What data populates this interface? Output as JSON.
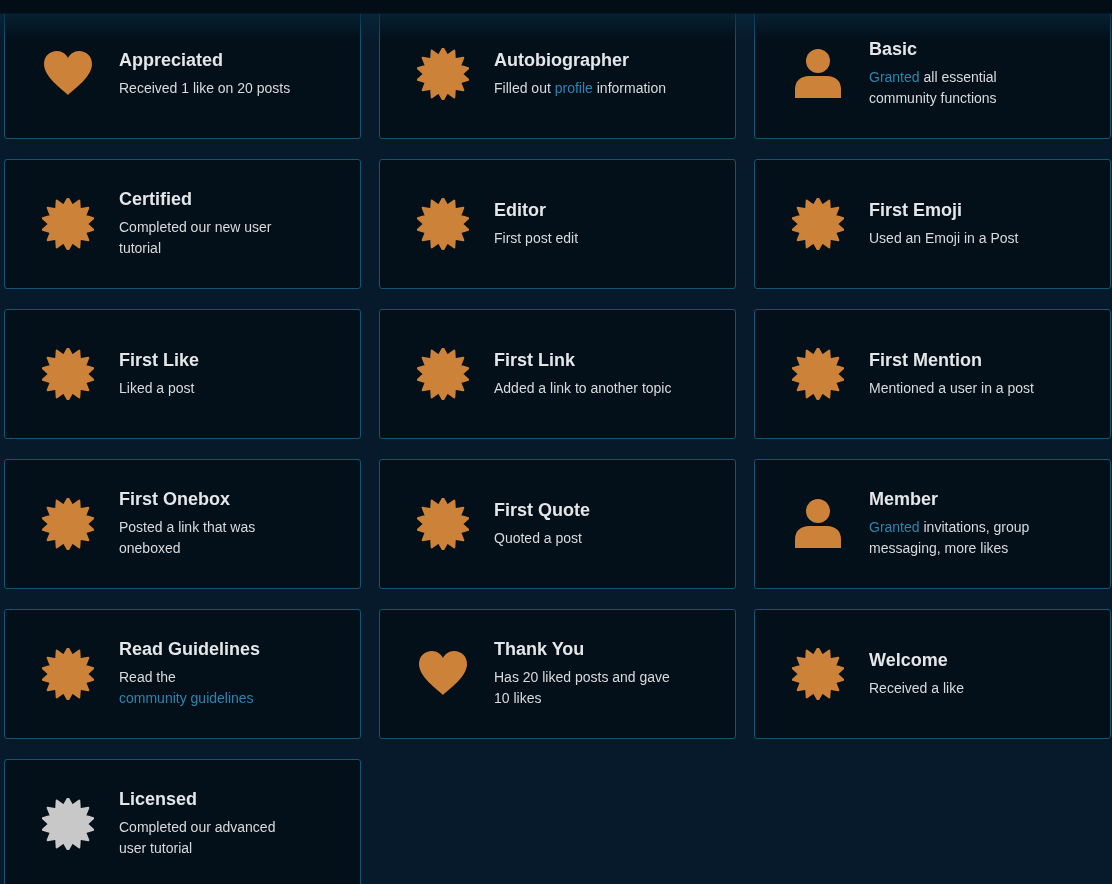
{
  "badges": [
    {
      "title": "Appreciated",
      "kind": "heart",
      "color": "#cd8239",
      "description": [
        {
          "text": "Received 1 like on 20 posts",
          "link": false
        }
      ]
    },
    {
      "title": "Autobiographer",
      "kind": "burst",
      "color": "#cd8239",
      "description": [
        {
          "text": "Filled out ",
          "link": false
        },
        {
          "text": "profile",
          "link": true
        },
        {
          "text": " information",
          "link": false
        }
      ]
    },
    {
      "title": "Basic",
      "kind": "person",
      "color": "#cd8239",
      "description": [
        {
          "text": "Granted",
          "link": true
        },
        {
          "text": " all essential community functions",
          "link": false
        }
      ]
    },
    {
      "title": "Certified",
      "kind": "burst",
      "color": "#cd8239",
      "description": [
        {
          "text": "Completed our new user tutorial",
          "link": false
        }
      ]
    },
    {
      "title": "Editor",
      "kind": "burst",
      "color": "#cd8239",
      "description": [
        {
          "text": "First post edit",
          "link": false
        }
      ]
    },
    {
      "title": "First Emoji",
      "kind": "burst",
      "color": "#cd8239",
      "description": [
        {
          "text": "Used an Emoji in a Post",
          "link": false
        }
      ]
    },
    {
      "title": "First Like",
      "kind": "burst",
      "color": "#cd8239",
      "description": [
        {
          "text": "Liked a post",
          "link": false
        }
      ]
    },
    {
      "title": "First Link",
      "kind": "burst",
      "color": "#cd8239",
      "description": [
        {
          "text": "Added a link to another topic",
          "link": false
        }
      ]
    },
    {
      "title": "First Mention",
      "kind": "burst",
      "color": "#cd8239",
      "description": [
        {
          "text": "Mentioned a user in a post",
          "link": false
        }
      ]
    },
    {
      "title": "First Onebox",
      "kind": "burst",
      "color": "#cd8239",
      "description": [
        {
          "text": "Posted a link that was oneboxed",
          "link": false
        }
      ]
    },
    {
      "title": "First Quote",
      "kind": "burst",
      "color": "#cd8239",
      "description": [
        {
          "text": "Quoted a post",
          "link": false
        }
      ]
    },
    {
      "title": "Member",
      "kind": "person",
      "color": "#cd8239",
      "description": [
        {
          "text": "Granted",
          "link": true
        },
        {
          "text": " invitations, group messaging, more likes",
          "link": false
        }
      ]
    },
    {
      "title": "Read Guidelines",
      "kind": "burst",
      "color": "#cd8239",
      "description": [
        {
          "text": "Read the ",
          "link": false
        },
        {
          "text": "community guidelines",
          "link": true
        }
      ]
    },
    {
      "title": "Thank You",
      "kind": "heart",
      "color": "#cd8239",
      "description": [
        {
          "text": "Has 20 liked posts and gave 10 likes",
          "link": false
        }
      ]
    },
    {
      "title": "Welcome",
      "kind": "burst",
      "color": "#cd8239",
      "description": [
        {
          "text": "Received a like",
          "link": false
        }
      ]
    },
    {
      "title": "Licensed",
      "kind": "burst",
      "color": "#c8c8c8",
      "description": [
        {
          "text": "Completed our advanced user tutorial",
          "link": false
        }
      ]
    }
  ]
}
